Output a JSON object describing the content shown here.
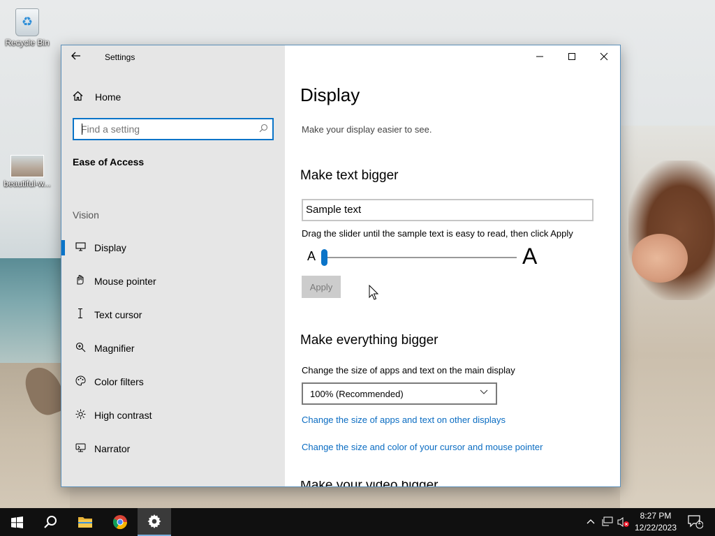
{
  "desktop": {
    "icons": [
      {
        "label": "Recycle Bin",
        "icon": "recycle-bin-icon"
      },
      {
        "label": "beautiful-w...",
        "icon": "image-file-icon"
      }
    ]
  },
  "window": {
    "title": "Settings",
    "controls": {
      "minimize": "—",
      "maximize": "☐",
      "close": "✕"
    }
  },
  "sidebar": {
    "home_label": "Home",
    "search": {
      "placeholder": "Find a setting",
      "value": ""
    },
    "section_title": "Ease of Access",
    "group_label": "Vision",
    "items": [
      {
        "label": "Display",
        "icon": "monitor-icon",
        "active": true
      },
      {
        "label": "Mouse pointer",
        "icon": "mouse-pointer-icon",
        "active": false
      },
      {
        "label": "Text cursor",
        "icon": "text-cursor-icon",
        "active": false
      },
      {
        "label": "Magnifier",
        "icon": "magnifier-icon",
        "active": false
      },
      {
        "label": "Color filters",
        "icon": "palette-icon",
        "active": false
      },
      {
        "label": "High contrast",
        "icon": "sun-icon",
        "active": false
      },
      {
        "label": "Narrator",
        "icon": "narrator-icon",
        "active": false
      }
    ]
  },
  "content": {
    "title": "Display",
    "description": "Make your display easier to see.",
    "text_bigger": {
      "heading": "Make text bigger",
      "sample_text": "Sample text",
      "instruction": "Drag the slider until the sample text is easy to read, then click Apply",
      "slider_min_label": "A",
      "slider_max_label": "A",
      "slider_value_fraction": 0.0,
      "apply_label": "Apply",
      "apply_enabled": false
    },
    "everything_bigger": {
      "heading": "Make everything bigger",
      "instruction": "Change the size of apps and text on the main display",
      "selected_scale": "100% (Recommended)",
      "link_other_displays": "Change the size of apps and text on other displays",
      "link_cursor": "Change the size and color of your cursor and mouse pointer"
    },
    "next_heading_partial": "Make your video bigger"
  },
  "taskbar": {
    "pinned": [
      "windows-start-icon",
      "search-icon",
      "file-explorer-icon",
      "chrome-icon",
      "settings-gear-icon"
    ],
    "time": "8:27 PM",
    "date": "12/22/2023",
    "notification_count": "1"
  },
  "colors": {
    "accent": "#0a74c8",
    "link": "#0a6cc2",
    "sidebar_bg": "#e6e6e6",
    "taskbar_bg": "#101010"
  }
}
